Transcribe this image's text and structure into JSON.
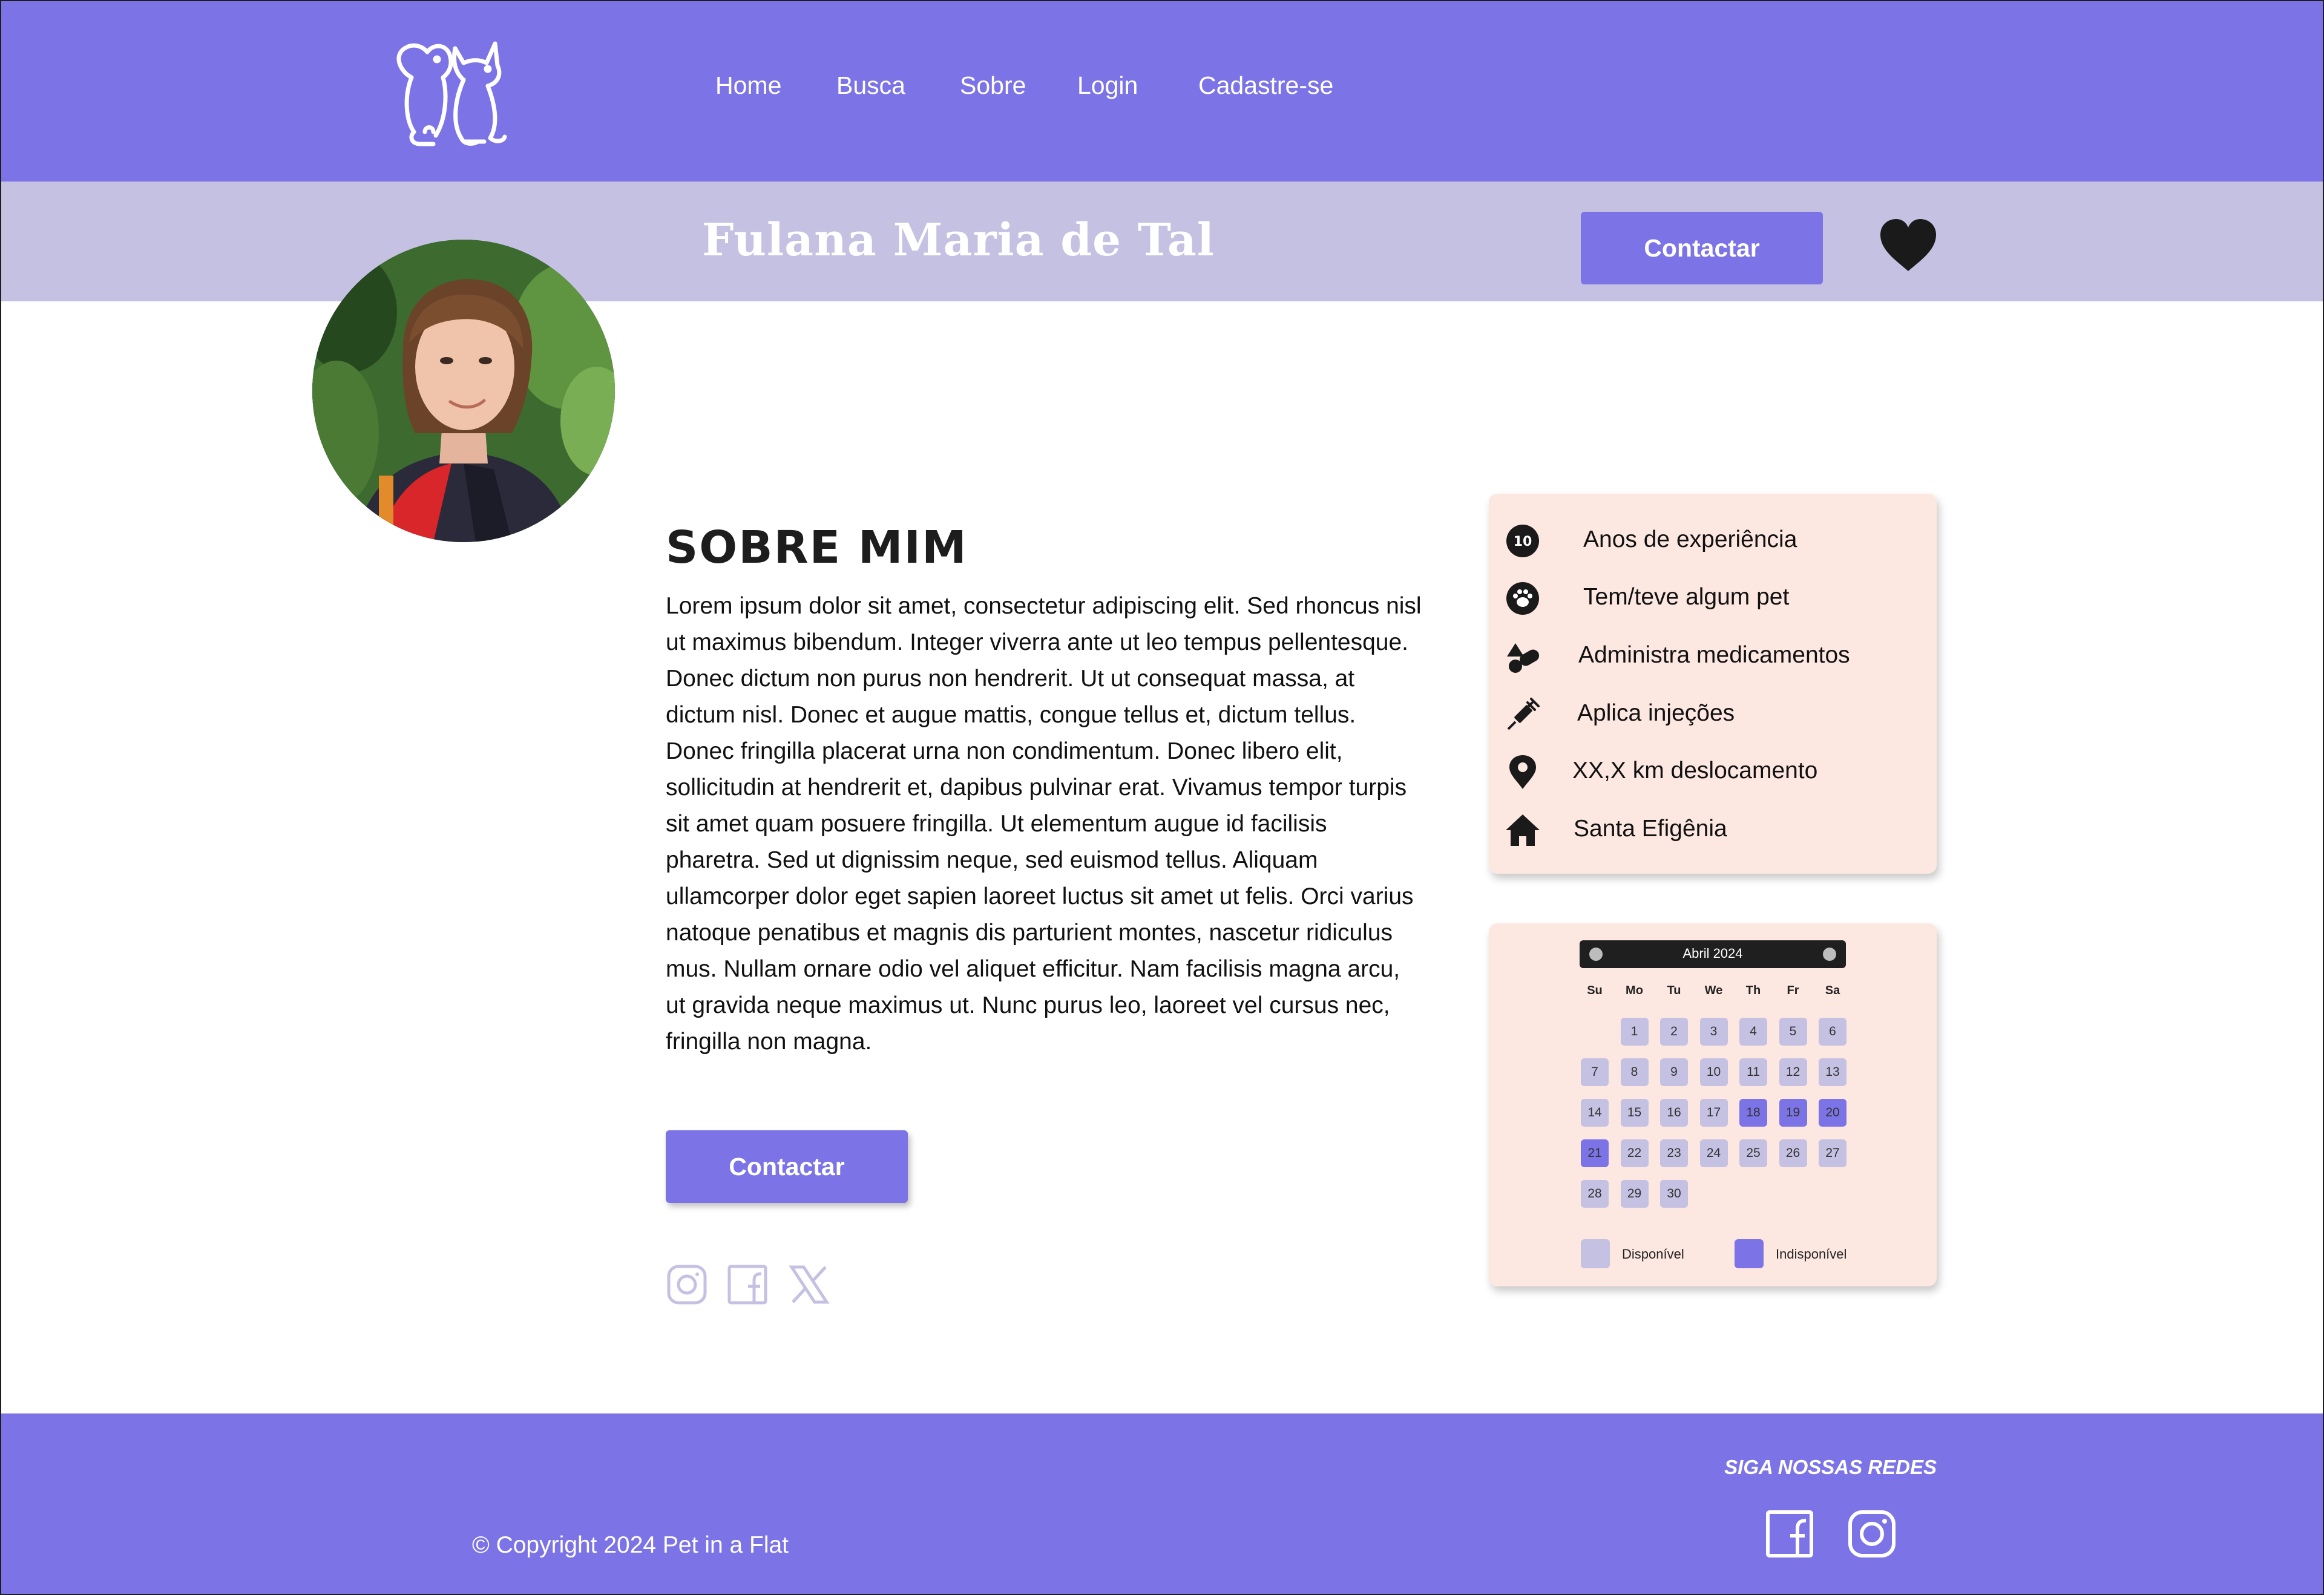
{
  "brand": {
    "logo_icon": "dog-cat-logo-icon"
  },
  "nav": {
    "items": [
      "Home",
      "Busca",
      "Sobre",
      "Login",
      "Cadastre-se"
    ]
  },
  "profile": {
    "name": "Fulana Maria de Tal",
    "contact_label": "Contactar",
    "favorite_icon": "heart-icon",
    "avatar": "profile-photo"
  },
  "about": {
    "title": "SOBRE MIM",
    "text": "Lorem ipsum dolor sit amet, consectetur adipiscing elit. Sed rhoncus nisl ut maximus bibendum. Integer viverra ante ut leo tempus pellentesque. Donec dictum non purus non hendrerit. Ut ut consequat massa, at dictum nisl. Donec et augue mattis, congue tellus et, dictum tellus. Donec fringilla placerat urna non condimentum. Donec libero elit, sollicitudin at hendrerit et, dapibus pulvinar erat. Vivamus tempor turpis sit amet quam posuere fringilla. Ut elementum augue id facilisis pharetra. Sed ut dignissim neque, sed euismod tellus. Aliquam ullamcorper dolor eget sapien laoreet luctus sit amet ut felis. Orci varius natoque penatibus et magnis dis parturient montes, nascetur ridiculus mus. Nullam ornare odio vel aliquet efficitur. Nam facilisis magna arcu, ut gravida neque maximus ut. Nunc purus leo, laoreet vel cursus nec, fringilla non magna.",
    "contact_label": "Contactar",
    "social_icons": [
      "instagram-icon",
      "facebook-icon",
      "x-icon"
    ]
  },
  "info": {
    "items": [
      {
        "icon": "ten-badge-icon",
        "badge": "10",
        "label": "Anos de experiência"
      },
      {
        "icon": "paw-icon",
        "label": "Tem/teve algum pet"
      },
      {
        "icon": "pills-icon",
        "label": "Administra medicamentos"
      },
      {
        "icon": "syringe-icon",
        "label": "Aplica injeções"
      },
      {
        "icon": "location-pin-icon",
        "label": "XX,X km deslocamento"
      },
      {
        "icon": "home-icon",
        "label": "Santa Efigênia"
      }
    ]
  },
  "calendar": {
    "month": "Abril 2024",
    "weekdays": [
      "Su",
      "Mo",
      "Tu",
      "We",
      "Th",
      "Fr",
      "Sa"
    ],
    "first_weekday_index": 1,
    "days_in_month": 30,
    "unavailable_days": [
      18,
      19,
      20,
      21
    ],
    "legend": {
      "available": "Disponível",
      "unavailable": "Indisponível"
    },
    "colors": {
      "available": "#c4c1e2",
      "unavailable": "#7c74e6"
    }
  },
  "footer": {
    "copyright": "© Copyright 2024 Pet in a Flat",
    "follow_label": "SIGA NOSSAS REDES",
    "social_icons": [
      "facebook-icon",
      "instagram-icon"
    ]
  },
  "colors": {
    "primary": "#7c74e6",
    "secondary": "#c4c1e2",
    "card_background": "#fde7e1",
    "text": "#1d1d1d"
  }
}
